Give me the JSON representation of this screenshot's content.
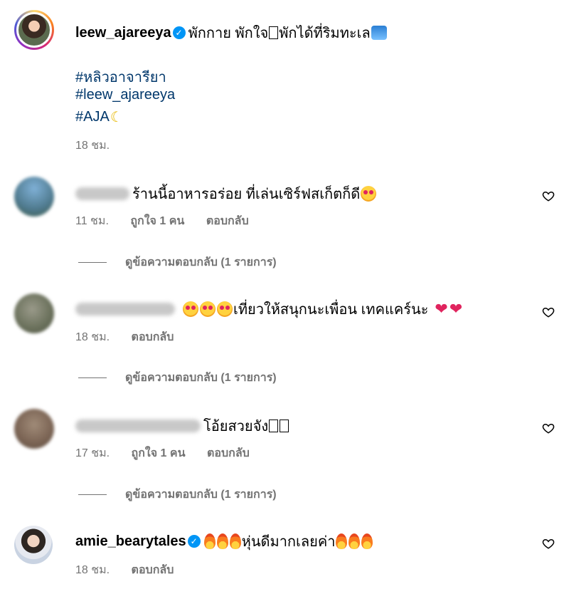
{
  "caption": {
    "username": "leew_ajareeya",
    "text": "พักกาย พักใจ",
    "text2": " พักได้ที่ริมทะเล",
    "hashtags": [
      "#หลิวอาจารียา",
      "#leew_ajareeya",
      "#AJA"
    ],
    "time": "18 ชม."
  },
  "comments": [
    {
      "text": "ร้านนี้อาหารอร่อย ที่เล่นเซิร์ฟสเก็ตก็ดี",
      "time": "11 ชม.",
      "likes": "ถูกใจ 1 คน",
      "reply": "ตอบกลับ",
      "view_replies": "ดูข้อความตอบกลับ (1 รายการ)"
    },
    {
      "text": "เที่ยวให้สนุกนะเพื่อน เทคแคร์นะ",
      "time": "18 ชม.",
      "reply": "ตอบกลับ",
      "view_replies": "ดูข้อความตอบกลับ (1 รายการ)"
    },
    {
      "text": "โอ้ยสวยจัง",
      "time": "17 ชม.",
      "likes": "ถูกใจ 1 คน",
      "reply": "ตอบกลับ",
      "view_replies": "ดูข้อความตอบกลับ (1 รายการ)"
    },
    {
      "username": "amie_bearytales",
      "text": "หุ่นดีมากเลยค่า",
      "time": "18 ชม.",
      "reply": "ตอบกลับ"
    }
  ],
  "icons": {
    "like": "heart-outline-icon",
    "verified": "verified-badge-icon"
  },
  "colors": {
    "link": "#00376b",
    "meta": "#737373",
    "verified": "#0095f6"
  }
}
